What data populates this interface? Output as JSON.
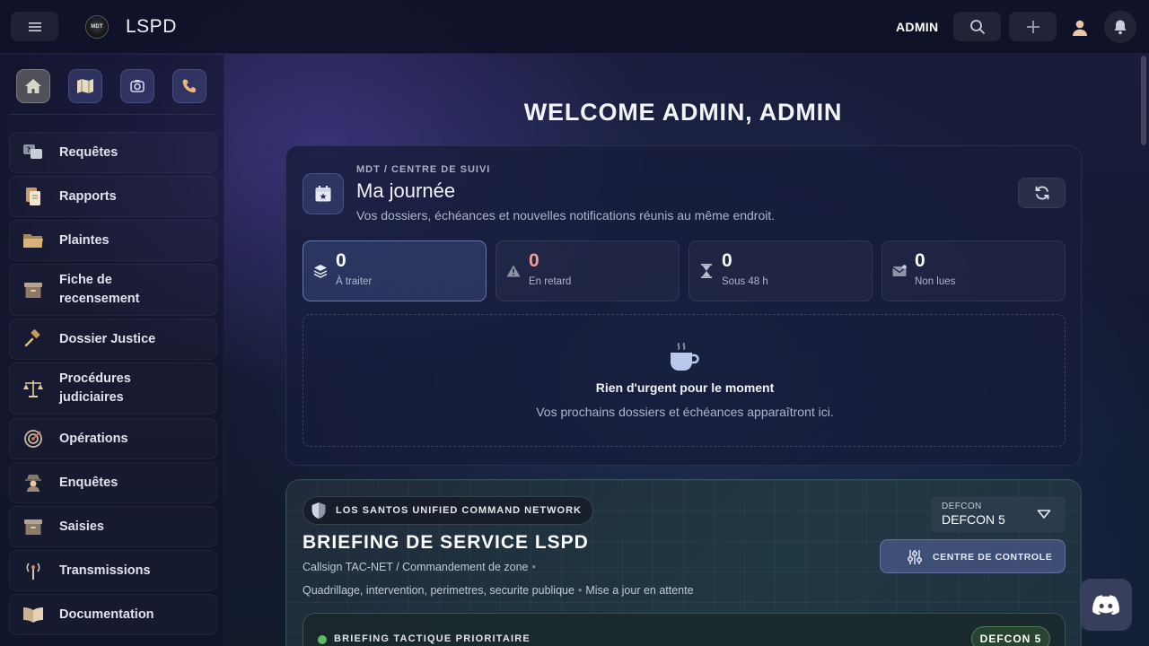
{
  "header": {
    "brand": "LSPD",
    "logo_text": "MDT",
    "user": "ADMIN"
  },
  "sidebar": {
    "quick_actions": [
      {
        "name": "home",
        "icon": "home-icon"
      },
      {
        "name": "map",
        "icon": "map-icon"
      },
      {
        "name": "camera",
        "icon": "camera-icon"
      },
      {
        "name": "phone",
        "icon": "phone-icon"
      }
    ],
    "items": [
      {
        "label": "Requêtes",
        "icon": "requests-icon"
      },
      {
        "label": "Rapports",
        "icon": "reports-icon"
      },
      {
        "label": "Plaintes",
        "icon": "folder-icon"
      },
      {
        "label": "Fiche de recensement",
        "icon": "archive-icon"
      },
      {
        "label": "Dossier Justice",
        "icon": "gavel-icon"
      },
      {
        "label": "Procédures judiciaires",
        "icon": "scales-icon"
      },
      {
        "label": "Opérations",
        "icon": "target-icon"
      },
      {
        "label": "Enquêtes",
        "icon": "detective-icon"
      },
      {
        "label": "Saisies",
        "icon": "box-icon"
      },
      {
        "label": "Transmissions",
        "icon": "antenna-icon"
      },
      {
        "label": "Documentation",
        "icon": "book-icon"
      }
    ]
  },
  "main": {
    "welcome": "WELCOME ADMIN, ADMIN",
    "day_card": {
      "eyebrow": "MDT / CENTRE DE SUIVI",
      "title": "Ma journée",
      "subtitle": "Vos dossiers, échéances et nouvelles notifications réunis au même endroit.",
      "stats": [
        {
          "value": "0",
          "label": "À traiter",
          "icon": "layers-icon"
        },
        {
          "value": "0",
          "label": "En retard",
          "icon": "warning-icon"
        },
        {
          "value": "0",
          "label": "Sous 48 h",
          "icon": "hourglass-icon"
        },
        {
          "value": "0",
          "label": "Non lues",
          "icon": "mail-icon"
        }
      ],
      "empty_title": "Rien d'urgent pour le moment",
      "empty_subtitle": "Vos prochains dossiers et échéances apparaîtront ici."
    },
    "briefing": {
      "network": "LOS SANTOS UNIFIED COMMAND NETWORK",
      "title": "BRIEFING DE SERVICE LSPD",
      "callsign": "Callsign TAC-NET / Commandement de zone",
      "scope": "Quadrillage, intervention, perimetres, securite publique",
      "update": "Mise a jour en attente",
      "defcon_label": "DEFCON",
      "defcon_value": "DEFCON 5",
      "control_button": "CENTRE DE CONTROLE",
      "priority_label": "BRIEFING TACTIQUE PRIORITAIRE",
      "priority_level": "DEFCON 5"
    }
  },
  "colors": {
    "accent": "#5b6bb5",
    "warning": "#f39c9c",
    "status_ok": "#5dbb63"
  }
}
